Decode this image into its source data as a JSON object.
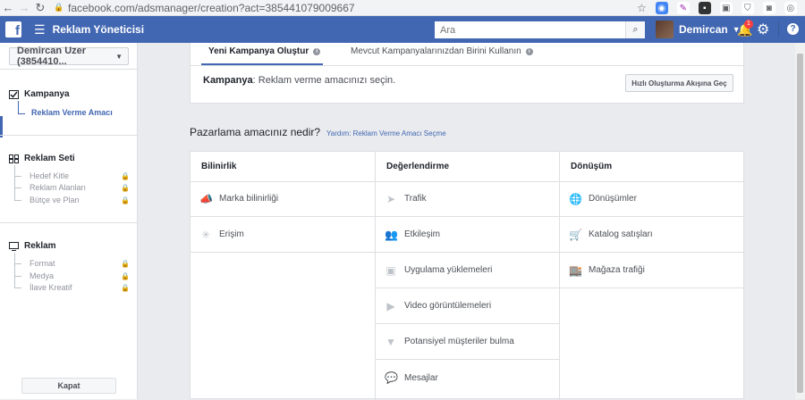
{
  "browser": {
    "url": "facebook.com/adsmanager/creation?act=385441079009667"
  },
  "header": {
    "title": "Reklam Yöneticisi",
    "search_placeholder": "Ara",
    "user_name": "Demircan",
    "notification_count": "1"
  },
  "sidebar": {
    "account_label": "Demircan Uzer (3854410...",
    "campaign": {
      "title": "Kampanya",
      "active_item": "Reklam Verme Amacı"
    },
    "adset": {
      "title": "Reklam Seti",
      "items": [
        "Hedef Kitle",
        "Reklam Alanları",
        "Bütçe ve Plan"
      ]
    },
    "ad": {
      "title": "Reklam",
      "items": [
        "Format",
        "Medya",
        "İlave Kreatif"
      ]
    },
    "close_label": "Kapat"
  },
  "top_card": {
    "tab_new": "Yeni Kampanya Oluştur",
    "tab_existing": "Mevcut Kampanyalarınızdan Birini Kullanın",
    "objective_bold": "Kampanya",
    "objective_text": ": Reklam verme amacınızı seçin.",
    "quick_button": "Hızlı Oluşturma Akışına Geç"
  },
  "objective": {
    "question": "Pazarlama amacınız nedir?",
    "help_link": "Yardım: Reklam Verme Amacı Seçme",
    "columns": [
      {
        "header": "Bilinirlik",
        "items": [
          {
            "label": "Marka bilinirliği",
            "icon": "megaphone-icon"
          },
          {
            "label": "Erişim",
            "icon": "reach-icon"
          }
        ]
      },
      {
        "header": "Değerlendirme",
        "items": [
          {
            "label": "Trafik",
            "icon": "cursor-icon"
          },
          {
            "label": "Etkileşim",
            "icon": "people-icon"
          },
          {
            "label": "Uygulama yüklemeleri",
            "icon": "box-icon"
          },
          {
            "label": "Video görüntülemeleri",
            "icon": "video-icon"
          },
          {
            "label": "Potansiyel müşteriler bulma",
            "icon": "filter-icon"
          },
          {
            "label": "Mesajlar",
            "icon": "chat-icon"
          }
        ]
      },
      {
        "header": "Dönüşüm",
        "items": [
          {
            "label": "Dönüşümler",
            "icon": "globe-icon"
          },
          {
            "label": "Katalog satışları",
            "icon": "cart-icon"
          },
          {
            "label": "Mağaza trafiği",
            "icon": "store-icon"
          }
        ]
      }
    ]
  }
}
